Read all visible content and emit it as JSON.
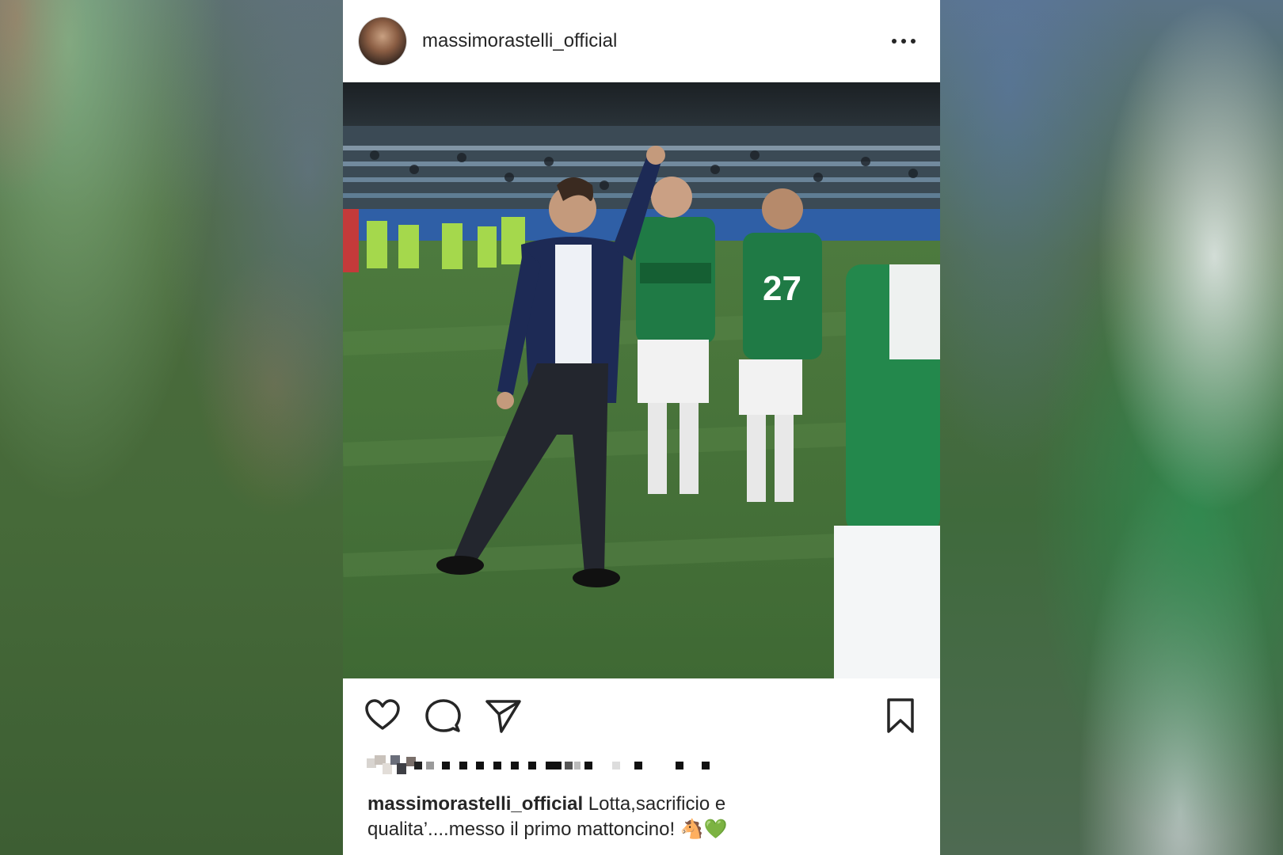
{
  "post": {
    "username": "massimorastelli_official",
    "more_icon": "more-horizontal-icon",
    "photo_alt": "",
    "actions": {
      "like_icon": "heart-icon",
      "comment_icon": "comment-icon",
      "share_icon": "send-icon",
      "save_icon": "bookmark-icon"
    },
    "caption": {
      "username": "massimorastelli_official",
      "line1": "Lotta,sacrificio e",
      "line2": "qualita’....messo il primo mattoncino! 🐴💚"
    }
  },
  "colors": {
    "text": "#262626",
    "card_bg": "#ffffff",
    "jersey_green": "#1f7a45",
    "pitch_green": "#4f7a3f"
  }
}
